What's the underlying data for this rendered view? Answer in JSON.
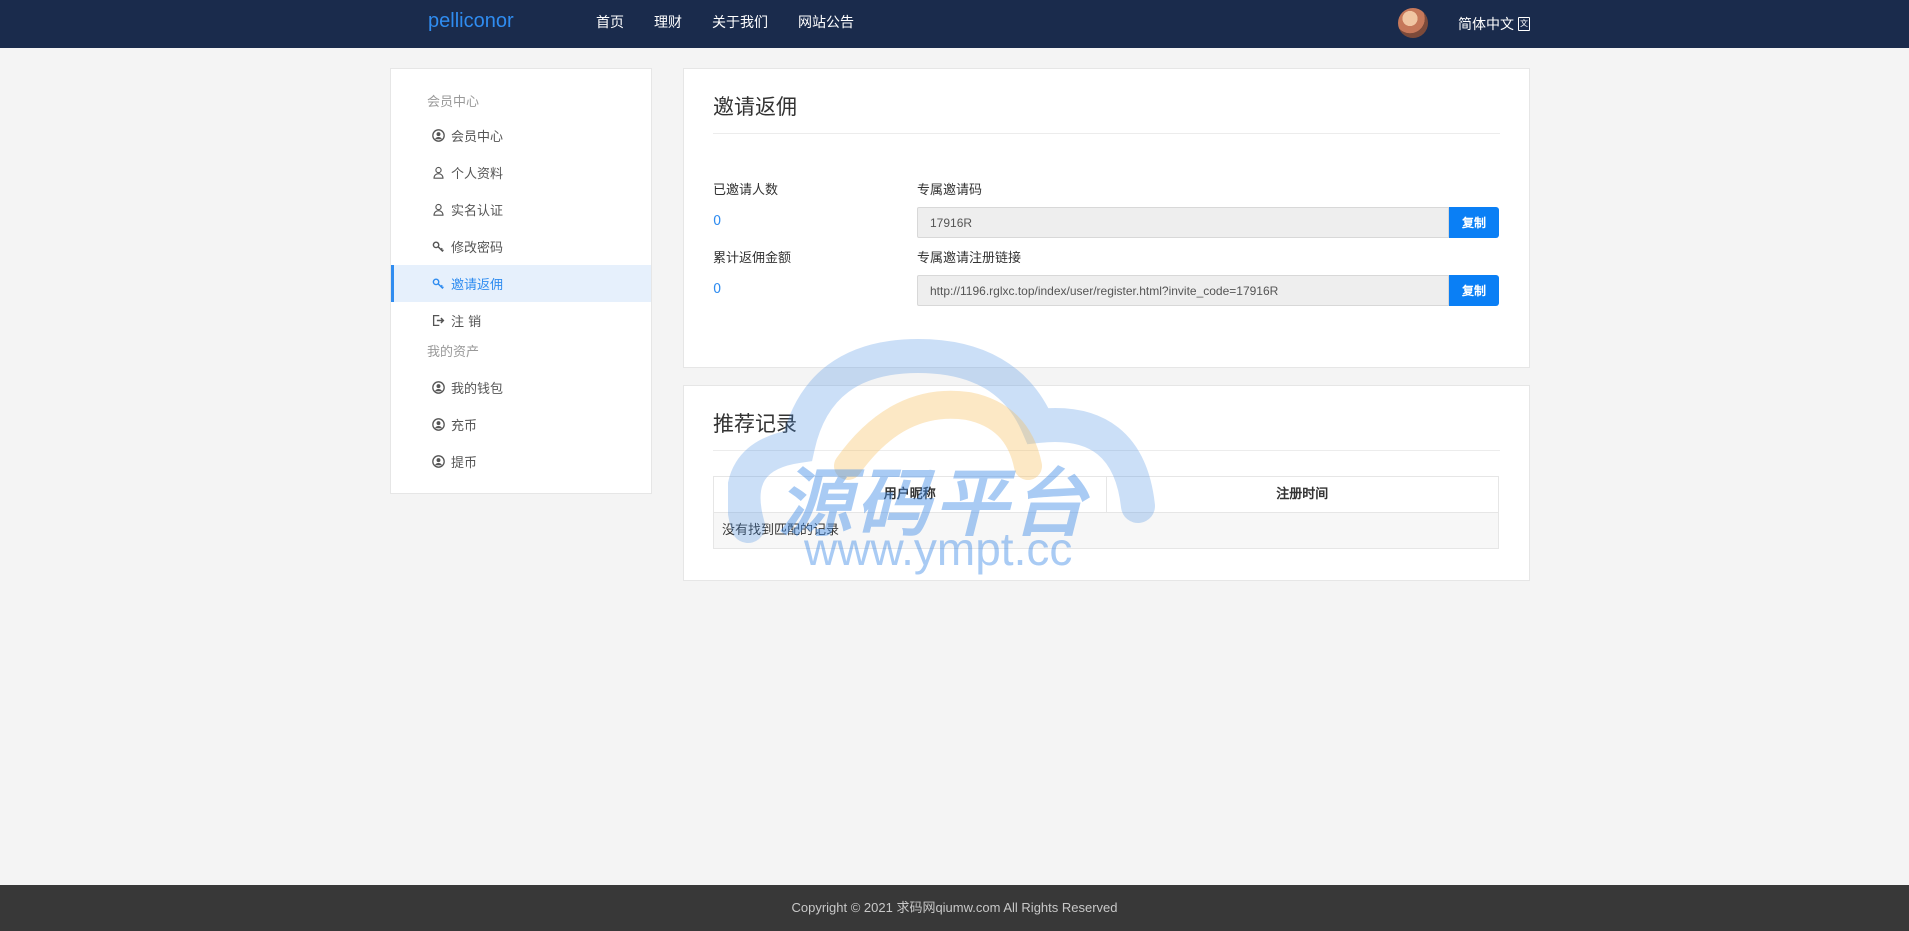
{
  "header": {
    "brand": "pelliconor",
    "nav": [
      "首页",
      "理财",
      "关于我们",
      "网站公告"
    ],
    "language": "简体中文"
  },
  "sidebar": {
    "groups": [
      {
        "title": "会员中心",
        "items": [
          {
            "label": "会员中心",
            "icon": "user-circle-icon"
          },
          {
            "label": "个人资料",
            "icon": "user-icon"
          },
          {
            "label": "实名认证",
            "icon": "user-icon"
          },
          {
            "label": "修改密码",
            "icon": "key-icon"
          },
          {
            "label": "邀请返佣",
            "icon": "key-icon",
            "active": true
          },
          {
            "label": "注 销",
            "icon": "sign-out-icon"
          }
        ]
      },
      {
        "title": "我的资产",
        "items": [
          {
            "label": "我的钱包",
            "icon": "user-circle-icon"
          },
          {
            "label": "充币",
            "icon": "user-circle-icon"
          },
          {
            "label": "提币",
            "icon": "user-circle-icon"
          }
        ]
      }
    ]
  },
  "invite": {
    "title": "邀请返佣",
    "invited_count_label": "已邀请人数",
    "invited_count": "0",
    "total_commission_label": "累计返佣金额",
    "total_commission": "0",
    "code_label": "专属邀请码",
    "code": "17916R",
    "link_label": "专属邀请注册链接",
    "link": "http://1196.rglxc.top/index/user/register.html?invite_code=17916R",
    "copy_label": "复制"
  },
  "records": {
    "title": "推荐记录",
    "columns": [
      "用户昵称",
      "注册时间"
    ],
    "empty_text": "没有找到匹配的记录"
  },
  "watermark": {
    "text": "源码平台",
    "url": "www.ympt.cc"
  },
  "footer": {
    "copyright": "Copyright © 2021 求码网qiumw.com All Rights Reserved"
  },
  "colors": {
    "nav_bg": "#1a2b4c",
    "accent": "#2f8cf0",
    "button": "#0a7ff5",
    "footer_bg": "#383838"
  }
}
